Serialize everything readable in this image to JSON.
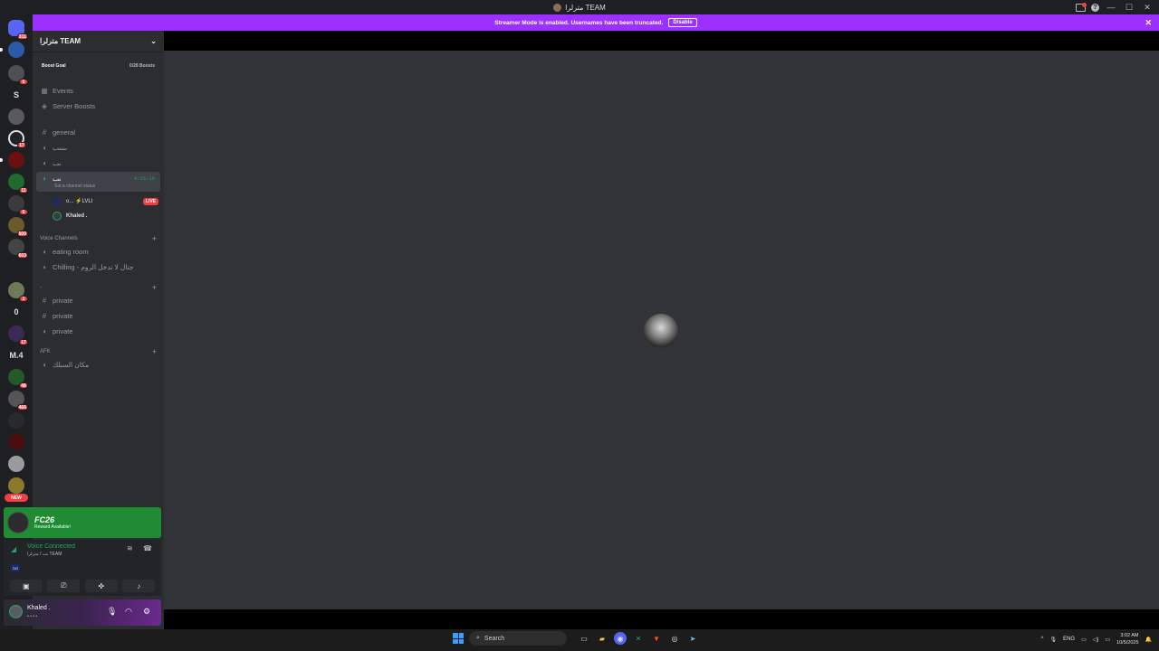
{
  "window": {
    "title": "مترلرا TEAM"
  },
  "banner": {
    "text": "Streamer Mode is enabled. Usernames have been truncated.",
    "button": "Disable"
  },
  "rail": {
    "badges": [
      "311",
      "6",
      "17",
      "11",
      "6",
      "500",
      "603",
      "2",
      "17",
      "48",
      "466"
    ],
    "text_servers": [
      "S",
      "0",
      "M.4"
    ],
    "new_label": "NEW"
  },
  "guild": {
    "name": "مترلرا TEAM"
  },
  "boost": {
    "label": "Boost Goal",
    "count": "0/28 Boosts"
  },
  "nav": {
    "events": "Events",
    "server_boosts": "Server Boosts"
  },
  "channels": {
    "general": "general",
    "ch2": "ٮٮٮٮٮ",
    "ch3": "ٮٮ",
    "active": "ٮٮ",
    "active_timer": "4:25:10",
    "active_status": "Set a channel status",
    "voice_users": [
      {
        "name": "ᴏ...  ⚡LVLI",
        "live": "LIVE"
      },
      {
        "name": "Khaled ."
      }
    ],
    "cat_voice": "Voice Channels",
    "eating": "eating room",
    "chilling": "Chilling - جتال لا تدخل الروم",
    "cat_private": "-",
    "private": [
      "private",
      "private",
      "private"
    ],
    "cat_afk": "AFK",
    "afk": "مكان السبلك"
  },
  "promo": {
    "title": "FC26",
    "sub": "Reward Available!"
  },
  "voice": {
    "status": "Voice Connected",
    "sub": "ٮٮ / مترلرا TEAM",
    "mini": "OG"
  },
  "user": {
    "name": "Khaled .",
    "status": "•  • • •"
  },
  "taskbar": {
    "search": "Search",
    "lang": "ENG",
    "time": "3:02 AM",
    "date": "10/5/2025"
  }
}
